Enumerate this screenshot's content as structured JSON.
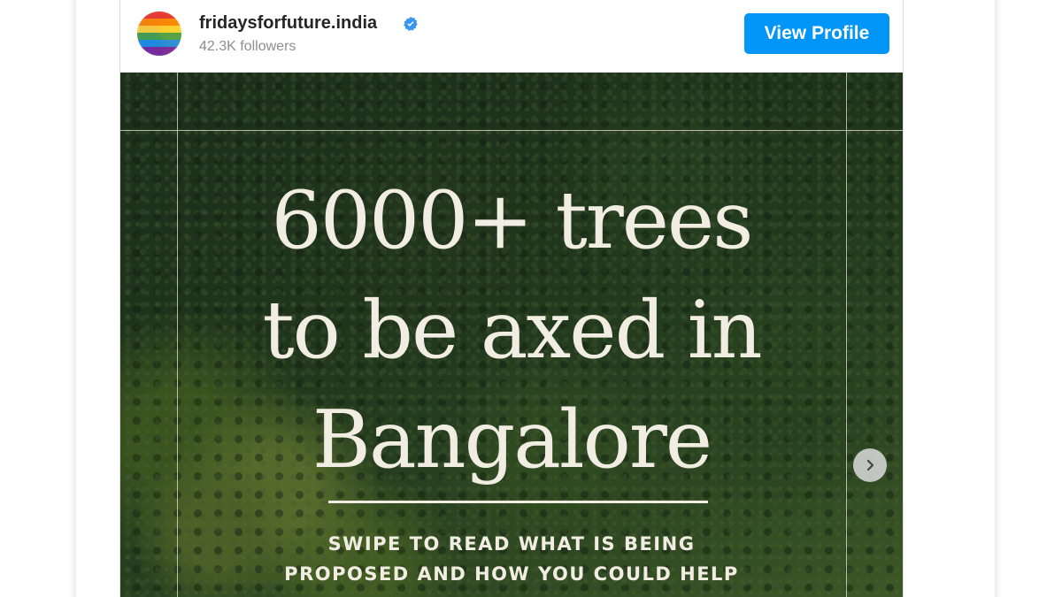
{
  "profile": {
    "username": "fridaysforfuture.india",
    "followers": "42.3K followers",
    "view_profile_label": "View Profile"
  },
  "post": {
    "headline_lines": [
      "6000+ trees",
      "to be axed in",
      "Bangalore"
    ],
    "cta_lines": [
      "SWIPE TO READ WHAT IS BEING",
      "PROPOSED AND HOW YOU COULD HELP"
    ]
  },
  "icons": {
    "verified": "verified-badge-icon",
    "next": "chevron-right-icon"
  },
  "colors": {
    "button": "#0095f6",
    "verified": "#3897f0",
    "text_primary": "#262626",
    "text_secondary": "#8e8e8e",
    "overlay_text": "#f1ede3"
  }
}
